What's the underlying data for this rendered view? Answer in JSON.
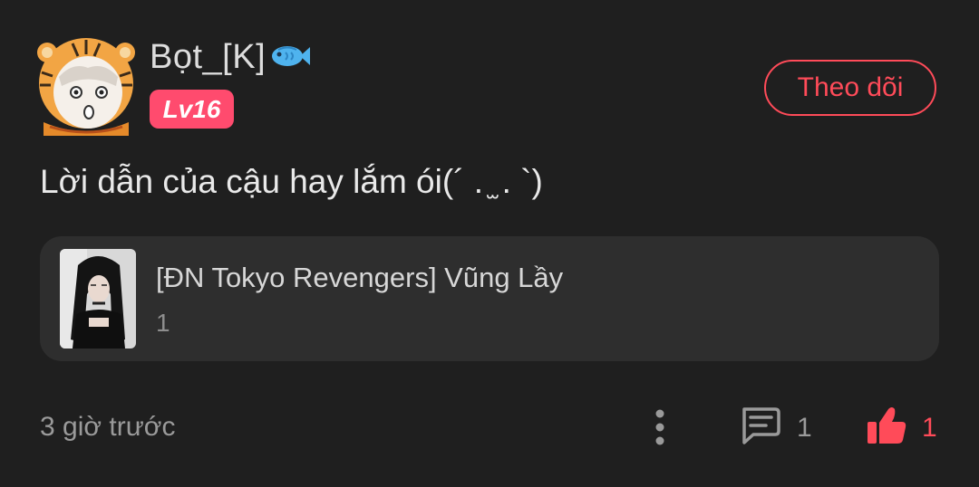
{
  "comment": {
    "user": {
      "name": "Bọt_[K]",
      "badge_icon": "fish-icon",
      "level": "Lv16",
      "avatar": "tiger-hood-avatar"
    },
    "follow_label": "Theo dõi",
    "text": "Lời dẫn của cậu hay lắm ói(´ . ̫ . `)",
    "story": {
      "title": "[ĐN Tokyo Revengers] Vũng Lầy",
      "chapters": "1",
      "cover": "story-cover-image"
    },
    "time": "3 giờ trước",
    "reply_count": "1",
    "like_count": "1"
  },
  "colors": {
    "background": "#1f1f1f",
    "card": "#2e2e2e",
    "accent": "#ff4b59",
    "level_badge": "#ff4b6e",
    "muted_text": "#9a9a9a"
  }
}
